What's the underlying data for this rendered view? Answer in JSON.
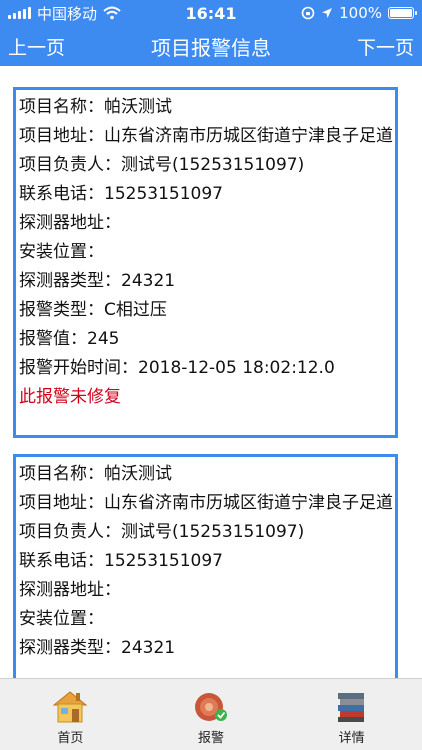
{
  "status_bar": {
    "carrier": "中国移动",
    "time": "16:41",
    "battery_text": "100%",
    "battery_level": 1.0
  },
  "nav": {
    "prev": "上一页",
    "title": "项目报警信息",
    "next": "下一页"
  },
  "alarms": [
    {
      "project_name": "项目名称：帕沃测试",
      "project_address": "项目地址：山东省济南市历城区街道宁津良子足道",
      "manager": "项目负责人：测试号(15253151097)",
      "phone": "联系电话：15253151097",
      "detector_address": "探测器地址：",
      "install_location": "安装位置：",
      "detector_type": "探测器类型：24321",
      "alarm_type": "报警类型：C相过压",
      "alarm_value": "报警值：245",
      "alarm_start": "报警开始时间：2018-12-05 18:02:12.0",
      "status": "此报警未修复"
    },
    {
      "project_name": "项目名称：帕沃测试",
      "project_address": "项目地址：山东省济南市历城区街道宁津良子足道",
      "manager": "项目负责人：测试号(15253151097)",
      "phone": "联系电话：15253151097",
      "detector_address": "探测器地址：",
      "install_location": "安装位置：",
      "detector_type": "探测器类型：24321"
    }
  ],
  "tabs": [
    {
      "label": "首页",
      "icon": "home-icon"
    },
    {
      "label": "报警",
      "icon": "alarm-icon"
    },
    {
      "label": "详情",
      "icon": "books-icon"
    }
  ],
  "colors": {
    "primary": "#3d8bf0",
    "alert": "#d0021b",
    "tabbar_bg": "#efefef"
  }
}
